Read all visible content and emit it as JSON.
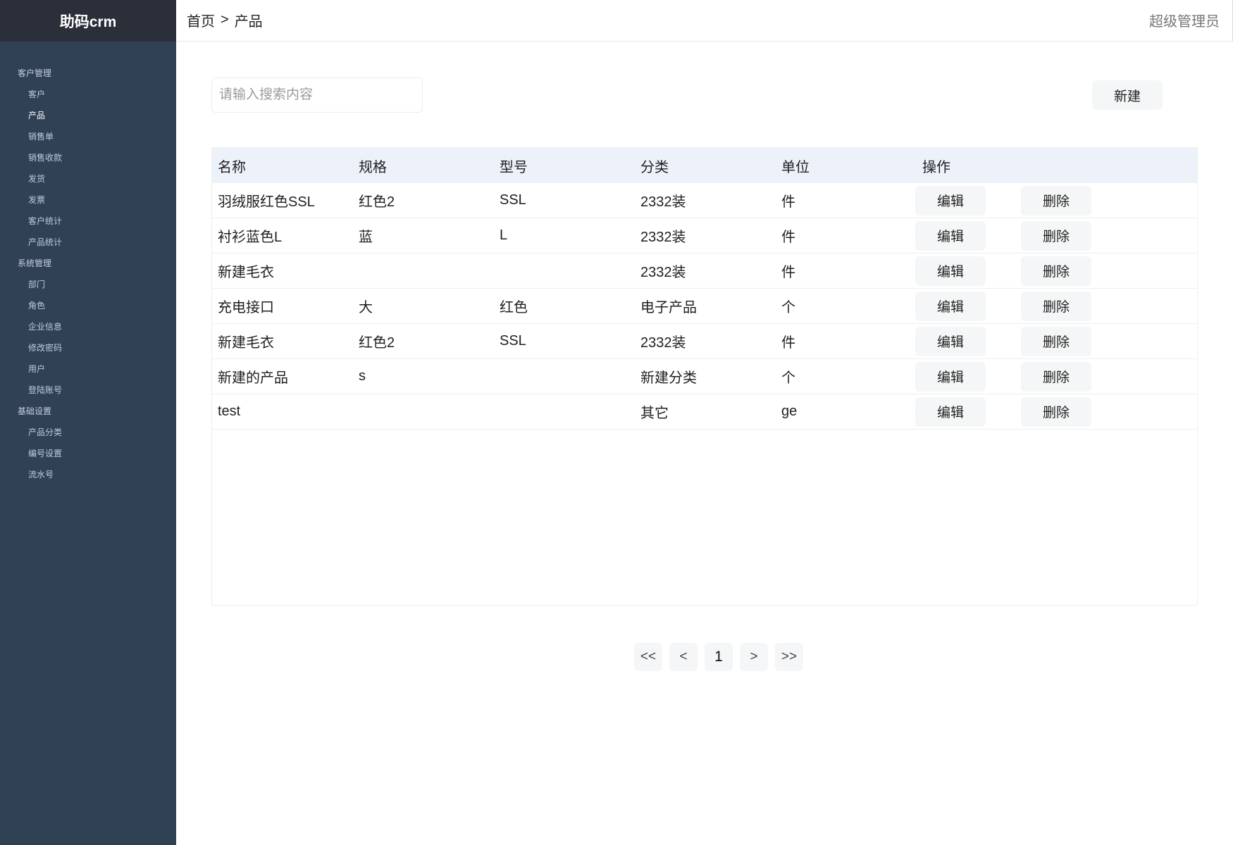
{
  "app": {
    "brand": "助码crm"
  },
  "sidebar": {
    "groups": [
      {
        "title": "客户管理",
        "items": [
          "客户",
          "产品",
          "销售单",
          "销售收款",
          "发货",
          "发票",
          "客户统计",
          "产品统计"
        ]
      },
      {
        "title": "系统管理",
        "items": [
          "部门",
          "角色",
          "企业信息",
          "修改密码",
          "用户",
          "登陆账号"
        ]
      },
      {
        "title": "基础设置",
        "items": [
          "产品分类",
          "编号设置",
          "流水号"
        ]
      }
    ],
    "active_item": "产品",
    "colors": {
      "background": "#304156",
      "brand_background": "#2b2f3a",
      "active_text": "#ffffff"
    }
  },
  "header": {
    "breadcrumb": {
      "home": "首页",
      "separator": ">",
      "current": "产品"
    },
    "user": "超级管理员"
  },
  "toolbar": {
    "search_placeholder": "请输入搜索内容",
    "search_value": "",
    "new_label": "新建"
  },
  "table": {
    "columns": [
      "名称",
      "规格",
      "型号",
      "分类",
      "单位",
      "操作"
    ],
    "rows": [
      {
        "name": "羽绒服红色SSL",
        "spec": "红色2",
        "model": "SSL",
        "category": "2332装",
        "unit": "件"
      },
      {
        "name": "衬衫蓝色L",
        "spec": "蓝",
        "model": "L",
        "category": "2332装",
        "unit": "件"
      },
      {
        "name": "新建毛衣",
        "spec": "",
        "model": "",
        "category": "2332装",
        "unit": "件"
      },
      {
        "name": "充电接口",
        "spec": "大",
        "model": "红色",
        "category": "电子产品",
        "unit": "个"
      },
      {
        "name": "新建毛衣",
        "spec": "红色2",
        "model": "SSL",
        "category": "2332装",
        "unit": "件"
      },
      {
        "name": "新建的产品",
        "spec": "s",
        "model": "",
        "category": "新建分类",
        "unit": "个"
      },
      {
        "name": "test",
        "spec": "",
        "model": "",
        "category": "其它",
        "unit": "ge"
      }
    ],
    "edit_label": "编辑",
    "delete_label": "删除",
    "header_color": "#edf1f9"
  },
  "pagination": {
    "first": "<<",
    "prev": "<",
    "current": "1",
    "next": ">",
    "last": ">>"
  }
}
